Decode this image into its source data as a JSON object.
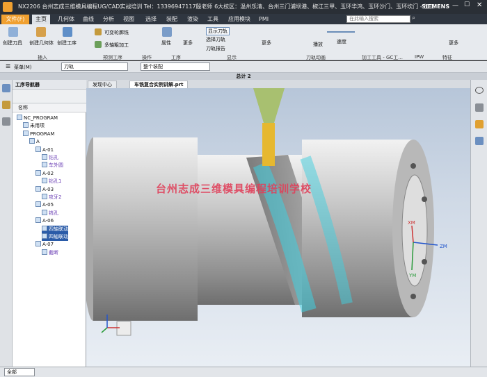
{
  "window": {
    "title": "NX2206 台州志成三维模具编程UG/CAD实战培训 Tel：13396947117殷老师 6大校区：温州乐清、台州三门浦坝港、椒江三甲、玉环华鸿、玉环沙门、玉环坎门 - 加工",
    "brand": "SIEMENS"
  },
  "menu": {
    "file": "文件(F)",
    "tabs": [
      "主页",
      "几何体",
      "曲线",
      "分析",
      "视图",
      "选择",
      "装配",
      "渲染",
      "工具",
      "应用模块",
      "PMI"
    ],
    "search_placeholder": "在此输入搜索"
  },
  "ribbon": {
    "buttons": [
      "创建刀具",
      "创建几何体",
      "创建工序",
      "可变轮廓铣",
      "多轴粗加工",
      "属性",
      "更多",
      "显示刀轨",
      "选择刀轨",
      "刀轨报告",
      "更多",
      "播放",
      "速度",
      "更多"
    ],
    "groups": [
      "插入",
      "预测工序",
      "操作",
      "工序",
      "显示",
      "刀轨动画",
      "加工工具 - GC工...",
      "IPW",
      "特征"
    ]
  },
  "toolbar2": {
    "menu": "菜单(M)",
    "filter": "刀轨",
    "scope": "整个装配"
  },
  "model_title": "总计 2",
  "navigator": {
    "title": "工序导航器",
    "column": "名称",
    "tree": [
      {
        "label": "NC_PROGRAM",
        "indent": 0
      },
      {
        "label": "未用项",
        "indent": 1
      },
      {
        "label": "PROGRAM",
        "indent": 1
      },
      {
        "label": "A",
        "indent": 2
      },
      {
        "label": "A-01",
        "indent": 3
      },
      {
        "label": "钻孔",
        "indent": 4,
        "op": true
      },
      {
        "label": "车外圆",
        "indent": 4,
        "op": true
      },
      {
        "label": "A-02",
        "indent": 3
      },
      {
        "label": "钻孔1",
        "indent": 4,
        "op": true
      },
      {
        "label": "A-03",
        "indent": 3
      },
      {
        "label": "攻牙2",
        "indent": 4,
        "op": true
      },
      {
        "label": "A-05",
        "indent": 3
      },
      {
        "label": "铣孔",
        "indent": 4,
        "op": true
      },
      {
        "label": "A-06",
        "indent": 3
      },
      {
        "label": "四轴联动",
        "indent": 4,
        "op": true,
        "selected": true
      },
      {
        "label": "四轴联动",
        "indent": 4,
        "op": true,
        "selected": true
      },
      {
        "label": "A-07",
        "indent": 3
      },
      {
        "label": "截断",
        "indent": 4,
        "op": true
      }
    ]
  },
  "tabs": [
    "发现中心",
    "车铣复合实例讲解.prt"
  ],
  "viewport": {
    "watermark": "台州志成三维模具编程培训学校",
    "axes": {
      "xm": "XM",
      "ym": "YM",
      "zm": "ZM"
    }
  },
  "status": {
    "filter": "全部"
  },
  "colors": {
    "file_tab": "#f0a030",
    "selection": "#2a5ba8",
    "toolpath": "#3fd0e0",
    "tool_holder": "#a8c070",
    "tool_bit": "#e6b830",
    "watermark": "#e0405a"
  }
}
